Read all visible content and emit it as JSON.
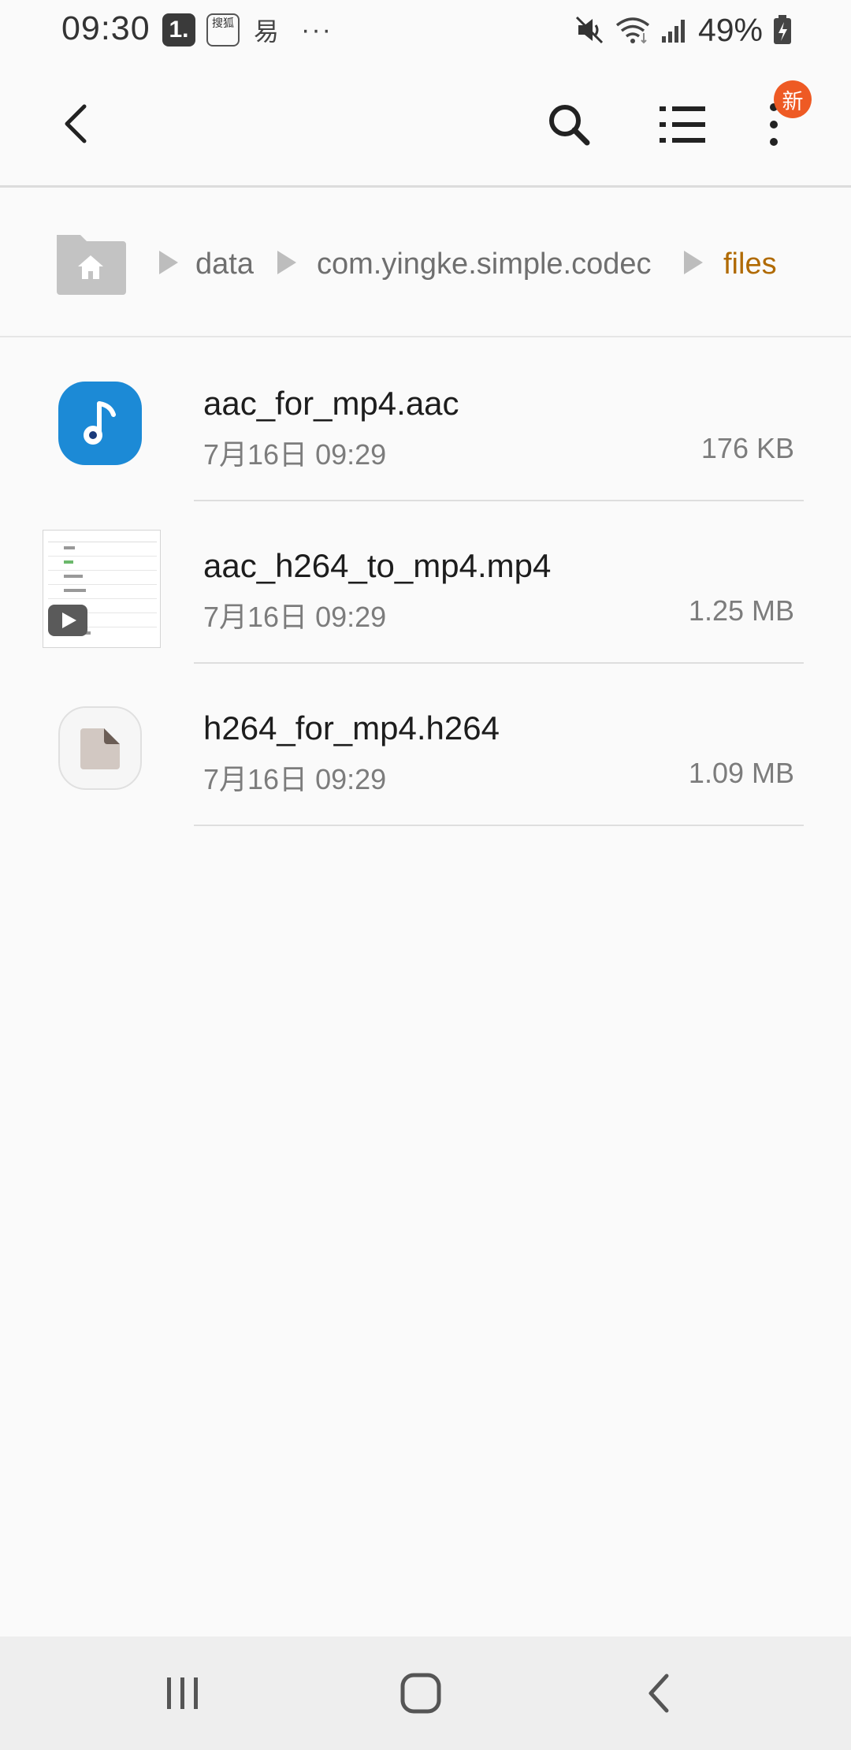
{
  "status_bar": {
    "time": "09:30",
    "notif_one": "1.",
    "notif_sohu": "搜狐",
    "notif_yi": "易",
    "more": "···",
    "battery": "49%"
  },
  "app_bar": {
    "back_icon": "back-arrow-icon",
    "search_icon": "search-icon",
    "list_icon": "list-view-icon",
    "more_icon": "more-vertical-icon",
    "new_badge": "新",
    "badge_color": "#ee5a24"
  },
  "breadcrumb": {
    "home_icon": "home-folder-icon",
    "items": [
      "data",
      "com.yingke.simple.codec",
      "files"
    ],
    "current_color": "#b06a00"
  },
  "files": [
    {
      "name": "aac_for_mp4.aac",
      "date": "7月16日 09:29",
      "size": "176 KB",
      "icon": "audio-note-icon"
    },
    {
      "name": "aac_h264_to_mp4.mp4",
      "date": "7月16日 09:29",
      "size": "1.25 MB",
      "icon": "video-thumbnail-icon"
    },
    {
      "name": "h264_for_mp4.h264",
      "date": "7月16日 09:29",
      "size": "1.09 MB",
      "icon": "generic-file-icon"
    }
  ],
  "nav_bar": {
    "recents_icon": "recents-icon",
    "home_icon": "home-icon",
    "back_icon": "back-icon"
  }
}
